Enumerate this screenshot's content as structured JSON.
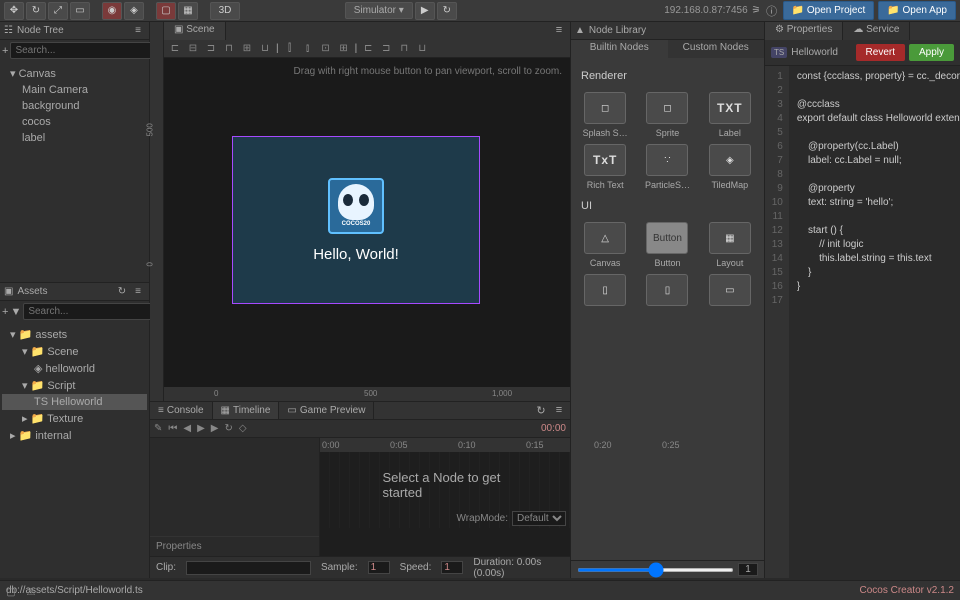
{
  "toolbar": {
    "btn_3d": "3D",
    "simulator": "Simulator ▾",
    "ip": "192.168.0.87:7456",
    "open_project": "Open Project",
    "open_app": "Open App"
  },
  "node_tree": {
    "title": "Node Tree",
    "search_ph": "Search...",
    "items": [
      "Canvas",
      "Main Camera",
      "background",
      "cocos",
      "label"
    ]
  },
  "assets": {
    "title": "Assets",
    "search_ph": "Search...",
    "items": [
      "assets",
      "Scene",
      "helloworld",
      "Script",
      "Helloworld",
      "Texture",
      "internal"
    ]
  },
  "scene": {
    "tab": "Scene",
    "hint": "Drag with right mouse button to pan viewport, scroll to zoom.",
    "hello": "Hello, World!",
    "logo_text": "COCOS20",
    "ruler_v": [
      "500",
      "0"
    ],
    "ruler_h": [
      "0",
      "500",
      "1,000"
    ]
  },
  "bottom": {
    "tabs": [
      "Console",
      "Timeline",
      "Game Preview"
    ],
    "time": "00:00",
    "ticks": [
      "0:00",
      "0:05",
      "0:10",
      "0:15",
      "0:20",
      "0:25"
    ],
    "props_label": "Properties",
    "msg": "Select a Node to get started",
    "wrap_label": "WrapMode:",
    "wrap_val": "Default",
    "clip_label": "Clip:",
    "sample_label": "Sample:",
    "sample_val": "1",
    "speed_label": "Speed:",
    "speed_val": "1",
    "duration": "Duration: 0.00s (0.00s)"
  },
  "nodelib": {
    "title": "Node Library",
    "tabs": [
      "Builtin Nodes",
      "Custom Nodes"
    ],
    "sec1": "Renderer",
    "items1": [
      "Splash S…",
      "Sprite",
      "Label",
      "Rich Text",
      "ParticleS…",
      "TiledMap"
    ],
    "icons1": [
      "◻",
      "◻",
      "TXT",
      "TxT",
      "∵",
      "◈"
    ],
    "sec2": "UI",
    "items2": [
      "Canvas",
      "Button",
      "Layout"
    ],
    "icons2": [
      "△",
      "Button",
      "▦"
    ],
    "slider_val": "1"
  },
  "inspector": {
    "tabs": [
      "Properties",
      "Service"
    ],
    "file": "Helloworld",
    "revert": "Revert",
    "apply": "Apply",
    "lines": 17,
    "code": [
      "const {ccclass, property} = cc._decor",
      "",
      "@ccclass",
      "export default class Helloworld exten",
      "",
      "    @property(cc.Label)",
      "    label: cc.Label = null;",
      "",
      "    @property",
      "    text: string = 'hello';",
      "",
      "    start () {",
      "        // init logic",
      "        this.label.string = this.text",
      "    }",
      "}",
      ""
    ]
  },
  "status": {
    "path": "db://assets/Script/Helloworld.ts",
    "version": "Cocos Creator v2.1.2"
  }
}
